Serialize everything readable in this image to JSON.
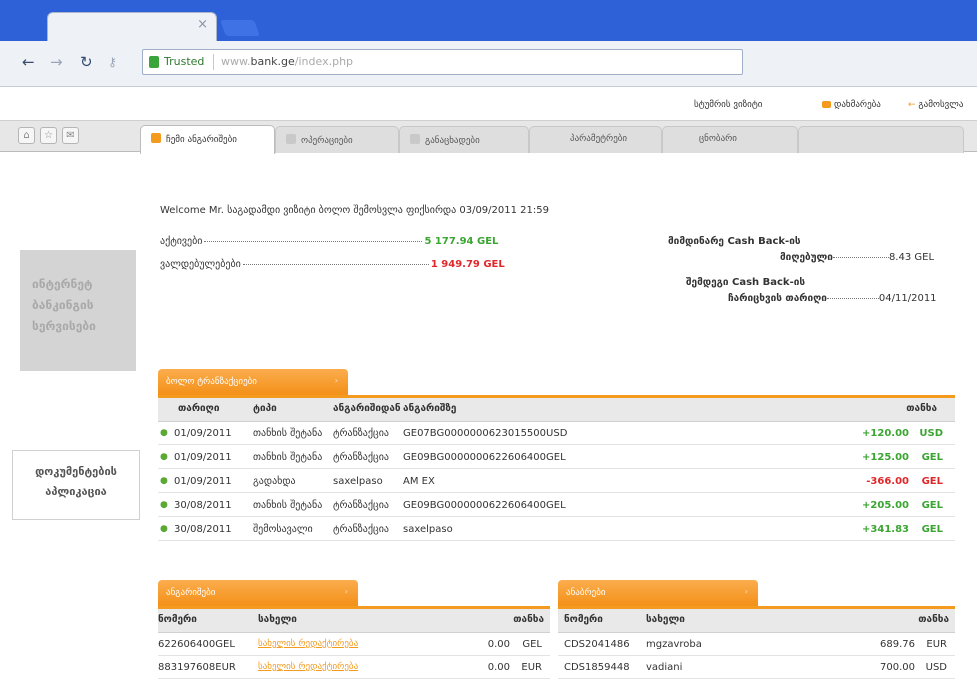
{
  "browser": {
    "tab_close": "×",
    "trusted_label": "Trusted",
    "url_prefix": "www.",
    "url_domain": "bank.ge",
    "url_path": "/index.php"
  },
  "utility": {
    "contact": "სტუმრის ვიზიტი",
    "login": "დახმარება",
    "logout": "გამოსვლა"
  },
  "nav": {
    "tabs": [
      "ჩემი ანგარიშები",
      "ოპერაციები",
      "განაცხადები",
      "პარამეტრები",
      "ცნობარი"
    ]
  },
  "welcome": "Welcome Mr. საგადამდი ვიზიტი ბოლო შემოსვლა ფიქსირდა 03/09/2011 21:59",
  "balances": {
    "assets_label": "აქტივები",
    "assets_value": "5 177.94 GEL",
    "liabilities_label": "ვალდებულებები",
    "liabilities_value": "1 949.79 GEL"
  },
  "cashback": {
    "line1a": "მიმდინარე Cash Back-ის",
    "line1b": "მიღებული",
    "value1": "8.43 GEL",
    "line2a": "შემდეგი Cash Back-ის",
    "line2b": "ჩარიცხვის თარიღი",
    "value2": "04/11/2011"
  },
  "sidebar": {
    "gray_lines": [
      "ინტერნეტ",
      "ბანკინგის",
      "სერვისები"
    ],
    "white_lines": [
      "დოკუმენტების",
      "აპლიკაცია"
    ]
  },
  "transactions": {
    "tab_label": "ბოლო ტრანზაქციები",
    "headers": [
      "თარიღი",
      "ტიპი",
      "ანგარიშიდან",
      "ანგარიშზე",
      "თანხა"
    ],
    "rows": [
      {
        "date": "01/09/2011",
        "type": "თანხის შეტანა",
        "from": "ტრანზაქცია",
        "to": "GE07BG0000000623015500USD",
        "amount": "+120.00",
        "cur": "USD",
        "neg": false
      },
      {
        "date": "01/09/2011",
        "type": "თანხის შეტანა",
        "from": "ტრანზაქცია",
        "to": "GE09BG0000000622606400GEL",
        "amount": "+125.00",
        "cur": "GEL",
        "neg": false
      },
      {
        "date": "01/09/2011",
        "type": "გადახდა",
        "from": "saxelpaso",
        "to": "AM EX",
        "amount": "-366.00",
        "cur": "GEL",
        "neg": true
      },
      {
        "date": "30/08/2011",
        "type": "თანხის შეტანა",
        "from": "ტრანზაქცია",
        "to": "GE09BG0000000622606400GEL",
        "amount": "+205.00",
        "cur": "GEL",
        "neg": false
      },
      {
        "date": "30/08/2011",
        "type": "შემოსავალი",
        "from": "ტრანზაქცია",
        "to": "saxelpaso",
        "amount": "+341.83",
        "cur": "GEL",
        "neg": false
      }
    ]
  },
  "accounts": {
    "tab_label": "ანგარიშები",
    "headers": [
      "ნომერი",
      "სახელი",
      "თანხა"
    ],
    "rows": [
      {
        "number": "622606400GEL",
        "name": "სახელის რედაქტირება",
        "amount": "0.00",
        "cur": "GEL"
      },
      {
        "number": "883197608EUR",
        "name": "სახელის რედაქტირება",
        "amount": "0.00",
        "cur": "EUR"
      }
    ]
  },
  "deposits": {
    "tab_label": "ანაბრები",
    "headers": [
      "ნომერი",
      "სახელი",
      "თანხა"
    ],
    "rows": [
      {
        "number": "CDS2041486",
        "name": "mgzavroba",
        "amount": "689.76",
        "cur": "EUR"
      },
      {
        "number": "CDS1859448",
        "name": "vadiani",
        "amount": "700.00",
        "cur": "USD"
      }
    ]
  }
}
